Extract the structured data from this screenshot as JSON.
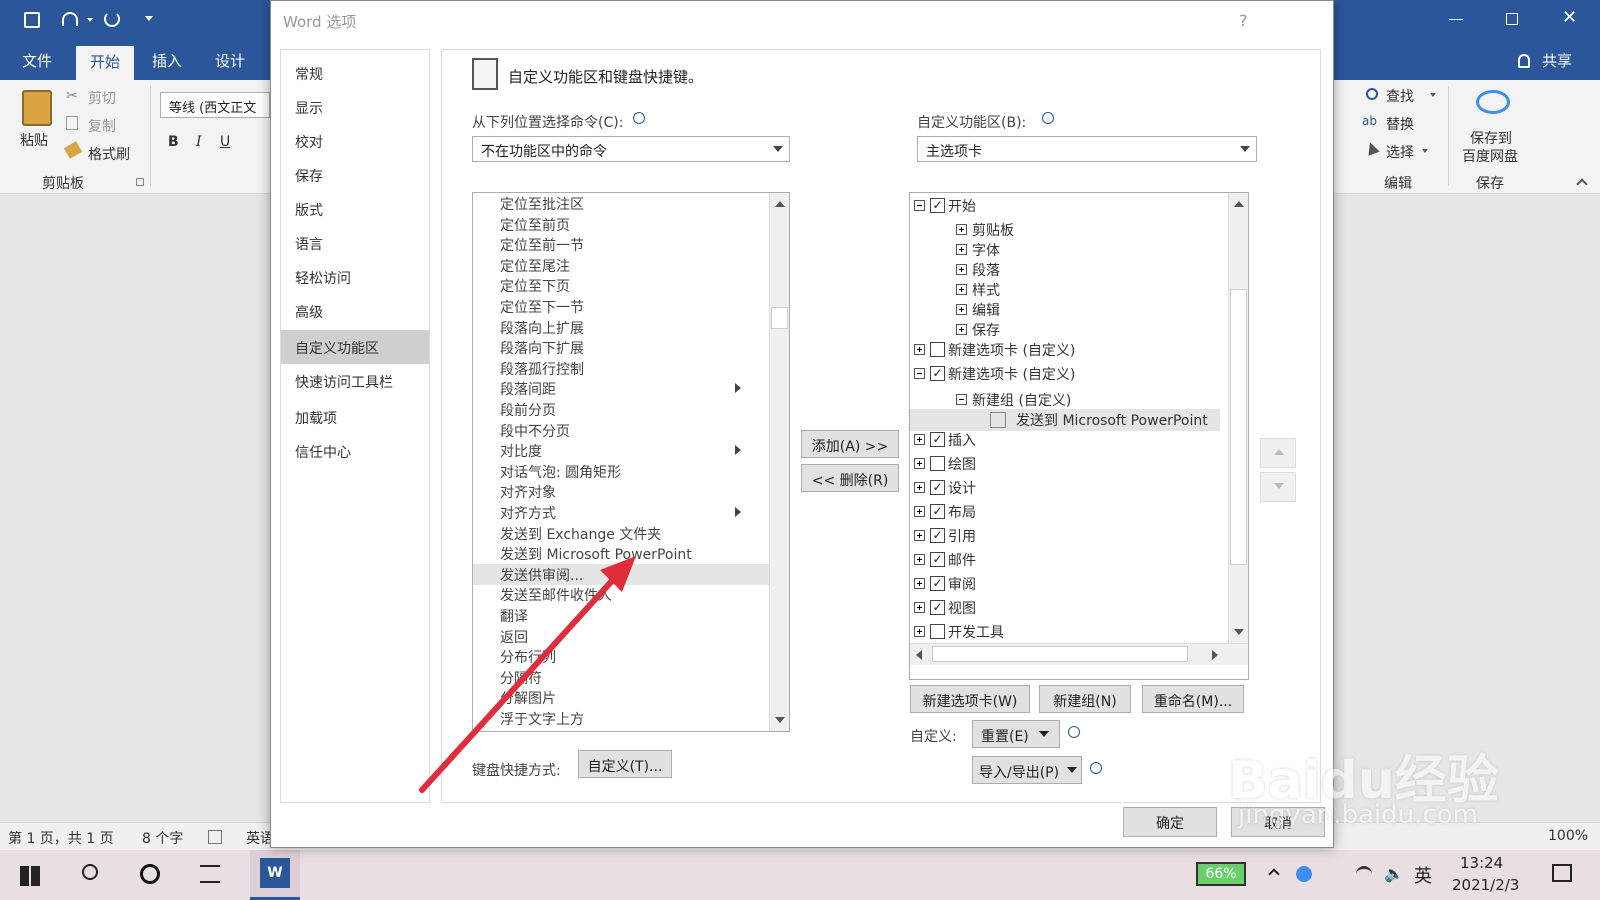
{
  "word": {
    "ribbon_tabs": [
      "文件",
      "开始",
      "插入",
      "设计"
    ],
    "share_label": "共享",
    "clipboard": {
      "paste": "粘贴",
      "cut": "剪切",
      "copy": "复制",
      "format_painter": "格式刷",
      "group": "剪贴板"
    },
    "font": {
      "name": "等线 (西文正文",
      "bold": "B",
      "italic": "I",
      "underline": "U"
    },
    "editing": {
      "find": "查找",
      "replace": "替换",
      "select": "选择",
      "group": "编辑"
    },
    "save": {
      "label1": "保存到",
      "label2": "百度网盘",
      "group": "保存"
    },
    "status": {
      "page": "第 1 页，共 1 页",
      "words": "8 个字",
      "lang": "英语",
      "zoom": "100%"
    }
  },
  "taskbar": {
    "battery": "66%",
    "ime": "英",
    "time": "13:24",
    "date": "2021/2/3",
    "app_badge": "W"
  },
  "dialog": {
    "title": "Word 选项",
    "help": "?",
    "nav": [
      "常规",
      "显示",
      "校对",
      "保存",
      "版式",
      "语言",
      "轻松访问",
      "高级",
      "自定义功能区",
      "快速访问工具栏",
      "加载项",
      "信任中心"
    ],
    "nav_selected": "自定义功能区",
    "heading": "自定义功能区和键盘快捷键。",
    "choose_label": "从下列位置选择命令(C):",
    "choose_value": "不在功能区中的命令",
    "customize_label": "自定义功能区(B):",
    "customize_value": "主选项卡",
    "commands": [
      {
        "label": "定位至批注区",
        "sub": false
      },
      {
        "label": "定位至前页",
        "sub": false
      },
      {
        "label": "定位至前一节",
        "sub": false
      },
      {
        "label": "定位至尾注",
        "sub": false
      },
      {
        "label": "定位至下页",
        "sub": false
      },
      {
        "label": "定位至下一节",
        "sub": false
      },
      {
        "label": "段落向上扩展",
        "sub": false
      },
      {
        "label": "段落向下扩展",
        "sub": false
      },
      {
        "label": "段落孤行控制",
        "sub": false
      },
      {
        "label": "段落间距",
        "sub": true
      },
      {
        "label": "段前分页",
        "sub": false
      },
      {
        "label": "段中不分页",
        "sub": false
      },
      {
        "label": "对比度",
        "sub": true
      },
      {
        "label": "对话气泡: 圆角矩形",
        "sub": false
      },
      {
        "label": "对齐对象",
        "sub": false
      },
      {
        "label": "对齐方式",
        "sub": true
      },
      {
        "label": "发送到 Exchange 文件夹",
        "sub": false
      },
      {
        "label": "发送到 Microsoft PowerPoint",
        "sub": false
      },
      {
        "label": "发送供审阅...",
        "sub": false
      },
      {
        "label": "发送至邮件收件人",
        "sub": false
      },
      {
        "label": "翻译",
        "sub": false
      },
      {
        "label": "返回",
        "sub": false
      },
      {
        "label": "分布行列",
        "sub": false
      },
      {
        "label": "分隔符",
        "sub": false
      },
      {
        "label": "分解图片",
        "sub": false
      },
      {
        "label": "浮于文字上方",
        "sub": false
      }
    ],
    "highlighted_command": "发送供审阅...",
    "add_button": "添加(A) >>",
    "remove_button": "<< 删除(R)",
    "tree": [
      {
        "label": "开始",
        "level": 0,
        "exp": "minus",
        "checked": true
      },
      {
        "label": "剪贴板",
        "level": 1,
        "exp": "plus"
      },
      {
        "label": "字体",
        "level": 1,
        "exp": "plus"
      },
      {
        "label": "段落",
        "level": 1,
        "exp": "plus"
      },
      {
        "label": "样式",
        "level": 1,
        "exp": "plus"
      },
      {
        "label": "编辑",
        "level": 1,
        "exp": "plus"
      },
      {
        "label": "保存",
        "level": 1,
        "exp": "plus"
      },
      {
        "label": "新建选项卡 (自定义)",
        "level": 0,
        "exp": "plus",
        "checked": false
      },
      {
        "label": "新建选项卡 (自定义)",
        "level": 0,
        "exp": "minus",
        "checked": true
      },
      {
        "label": "新建组 (自定义)",
        "level": 1,
        "exp": "minus"
      },
      {
        "label": "发送到 Microsoft PowerPoint",
        "level": 2,
        "exp": "none"
      },
      {
        "label": "插入",
        "level": 0,
        "exp": "plus",
        "checked": true
      },
      {
        "label": "绘图",
        "level": 0,
        "exp": "plus",
        "checked": false
      },
      {
        "label": "设计",
        "level": 0,
        "exp": "plus",
        "checked": true
      },
      {
        "label": "布局",
        "level": 0,
        "exp": "plus",
        "checked": true
      },
      {
        "label": "引用",
        "level": 0,
        "exp": "plus",
        "checked": true
      },
      {
        "label": "邮件",
        "level": 0,
        "exp": "plus",
        "checked": true
      },
      {
        "label": "审阅",
        "level": 0,
        "exp": "plus",
        "checked": true
      },
      {
        "label": "视图",
        "level": 0,
        "exp": "plus",
        "checked": true
      },
      {
        "label": "开发工具",
        "level": 0,
        "exp": "plus",
        "checked": false
      }
    ],
    "new_tab_button": "新建选项卡(W)",
    "new_group_button": "新建组(N)",
    "rename_button": "重命名(M)...",
    "customize_text": "自定义:",
    "reset_button": "重置(E)",
    "import_export_button": "导入/导出(P)",
    "keyboard_label": "键盘快捷方式:",
    "keyboard_button": "自定义(T)...",
    "ok_button": "确定",
    "cancel_button": "取消"
  },
  "watermark": {
    "logo": "Baidu经验",
    "url": "jingyan.baidu.com"
  },
  "colors": {
    "word_blue": "#2b579a",
    "arrow_red": "#e02d3c",
    "selection_gray": "#cfcfcf"
  }
}
